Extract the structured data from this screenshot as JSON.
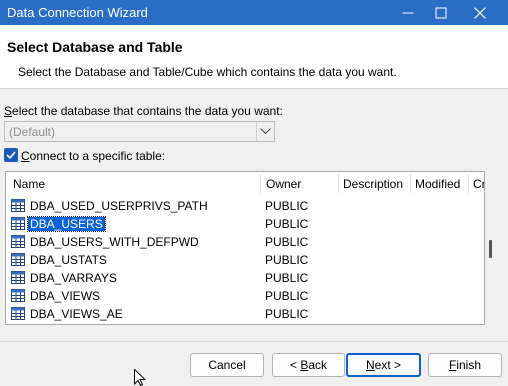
{
  "window": {
    "title": "Data Connection Wizard",
    "titlebar_color": "#2b6cc4"
  },
  "header": {
    "title": "Select Database and Table",
    "subtitle": "Select the Database and Table/Cube which contains the data you want."
  },
  "database": {
    "label_mnemonic": "S",
    "label_rest": "elect the database that contains the data you want:",
    "value": "(Default)"
  },
  "connect_checkbox": {
    "checked": true,
    "label_mnemonic": "C",
    "label_rest": "onnect to a specific table:"
  },
  "table_list": {
    "columns": [
      "Name",
      "Owner",
      "Description",
      "Modified",
      "Cr"
    ],
    "rows": [
      {
        "name": "DBA_USED_USERPRIVS_PATH",
        "owner": "PUBLIC",
        "selected": false
      },
      {
        "name": "DBA_USERS",
        "owner": "PUBLIC",
        "selected": true
      },
      {
        "name": "DBA_USERS_WITH_DEFPWD",
        "owner": "PUBLIC",
        "selected": false
      },
      {
        "name": "DBA_USTATS",
        "owner": "PUBLIC",
        "selected": false
      },
      {
        "name": "DBA_VARRAYS",
        "owner": "PUBLIC",
        "selected": false
      },
      {
        "name": "DBA_VIEWS",
        "owner": "PUBLIC",
        "selected": false
      },
      {
        "name": "DBA_VIEWS_AE",
        "owner": "PUBLIC",
        "selected": false
      }
    ],
    "selection_color": "#0c63d8"
  },
  "buttons": {
    "cancel": "Cancel",
    "back_prefix": "< ",
    "back_mnemonic": "B",
    "back_rest": "ack",
    "next_mnemonic": "N",
    "next_rest": "ext >",
    "finish_mnemonic": "F",
    "finish_rest": "inish"
  },
  "icons": {
    "minimize": "minimize-icon",
    "maximize": "maximize-icon",
    "close": "close-icon",
    "table": "table-icon",
    "dropdown": "chevron-down-icon",
    "check": "checkmark-icon",
    "cursor": "mouse-pointer-icon"
  }
}
